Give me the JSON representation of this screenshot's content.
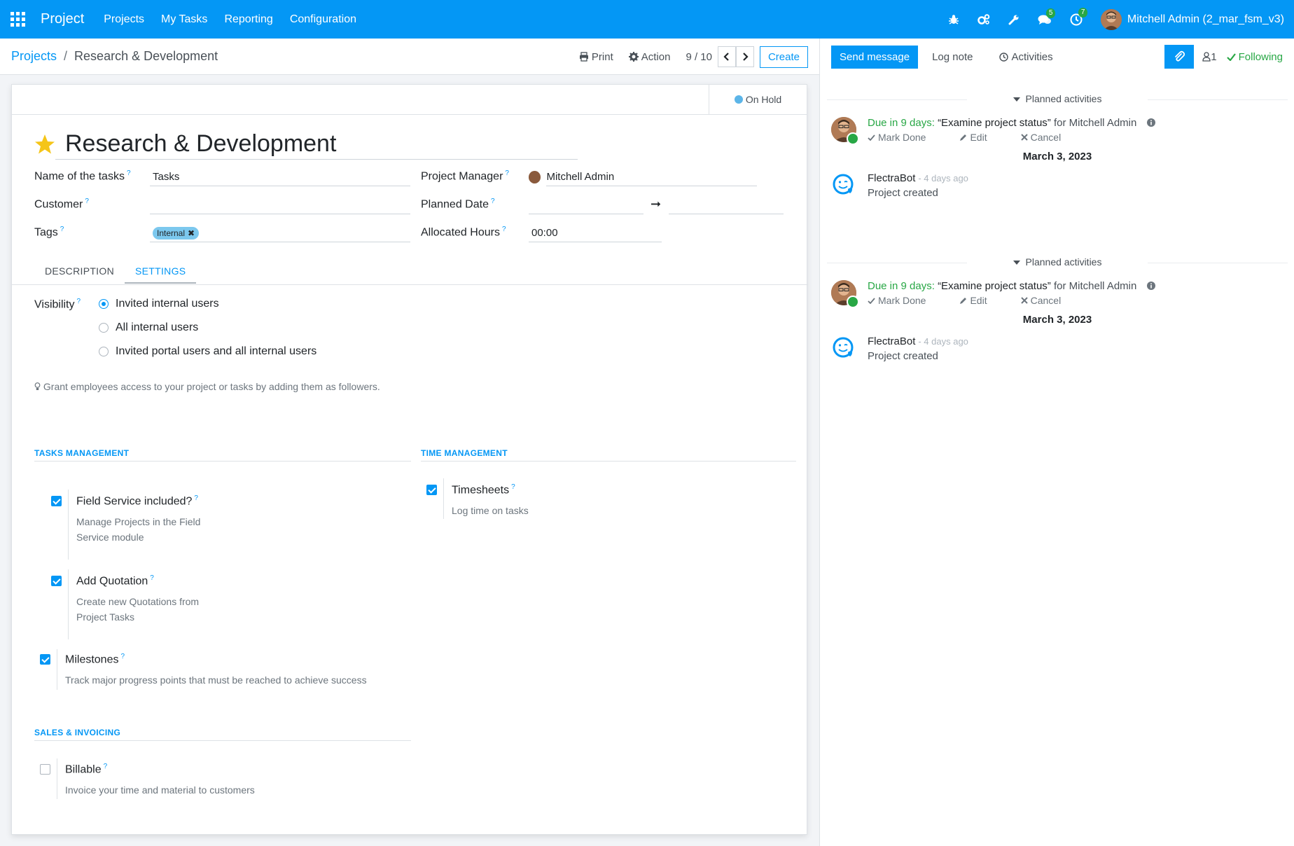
{
  "topbar": {
    "brand": "Project",
    "menu": [
      "Projects",
      "My Tasks",
      "Reporting",
      "Configuration"
    ],
    "messages_badge": "5",
    "activities_badge": "7",
    "user": "Mitchell Admin (2_mar_fsm_v3)",
    "icons": [
      "apps-grid-icon",
      "bug-icon",
      "cogs-icon",
      "wrench-icon",
      "chat-icon",
      "clock-icon"
    ]
  },
  "control": {
    "breadcrumb_parent": "Projects",
    "breadcrumb_sep": "/",
    "breadcrumb_current": "Research & Development",
    "print": "Print",
    "action": "Action",
    "pager": "9 / 10",
    "create": "Create"
  },
  "form": {
    "status": "On Hold",
    "title": "Research & Development",
    "fields": {
      "name_tasks_label": "Name of the tasks",
      "name_tasks_value": "Tasks",
      "customer_label": "Customer",
      "customer_value": "",
      "tags_label": "Tags",
      "tag": "Internal",
      "tag_remove": "✖",
      "pm_label": "Project Manager",
      "pm_value": "Mitchell Admin",
      "planned_label": "Planned Date",
      "planned_arrow": "➞",
      "hours_label": "Allocated Hours",
      "hours_value": "00:00",
      "help": "?"
    },
    "tabs": [
      "DESCRIPTION",
      "SETTINGS"
    ],
    "visibility_label": "Visibility",
    "visibility_options": [
      "Invited internal users",
      "All internal users",
      "Invited portal users and all internal users"
    ],
    "hint": "Grant employees access to your project or tasks by adding them as followers.",
    "groups": {
      "tasks": "TASKS MANAGEMENT",
      "time": "TIME MANAGEMENT",
      "sales": "SALES & INVOICING"
    },
    "settings": {
      "field_service_title": "Field Service included?",
      "field_service_desc": "Manage Projects in the Field Service module",
      "quotation_title": "Add Quotation",
      "quotation_desc": "Create new Quotations from Project Tasks",
      "milestones_title": "Milestones",
      "milestones_desc": "Track major progress points that must be reached to achieve success",
      "timesheets_title": "Timesheets",
      "timesheets_desc": "Log time on tasks",
      "billable_title": "Billable",
      "billable_desc": "Invoice your time and material to customers"
    }
  },
  "chatter": {
    "send_message": "Send message",
    "log_note": "Log note",
    "activities": "Activities",
    "followers": "1",
    "following": "Following",
    "planned_activities": "Planned activities",
    "activity": {
      "due": "Due in 9 days:",
      "title": "“Examine project status”",
      "for": "for Mitchell Admin",
      "mark_done": "Mark Done",
      "edit": "Edit",
      "cancel": "Cancel"
    },
    "date": "March 3, 2023",
    "message": {
      "author": "FlectraBot",
      "time": "- 4 days ago",
      "body": "Project created"
    }
  },
  "colors": {
    "primary": "#0497f5",
    "success": "#28a745",
    "tag": "#7cc8ee"
  }
}
